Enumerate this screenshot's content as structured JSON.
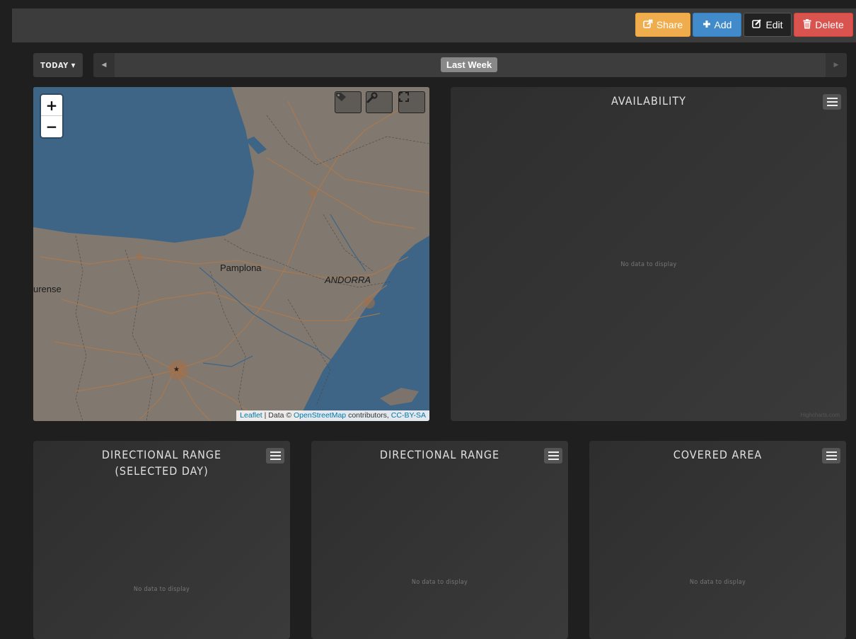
{
  "toolbar": {
    "share_label": "Share",
    "add_label": "Add",
    "edit_label": "Edit",
    "delete_label": "Delete"
  },
  "date_nav": {
    "today_label": "TODAY",
    "range_label": "Last Week"
  },
  "map": {
    "zoom_in": "+",
    "zoom_out": "−",
    "labels": {
      "pamplona": "Pamplona",
      "andorra": "ANDORRA",
      "ourense": "urense"
    },
    "attribution": {
      "leaflet": "Leaflet",
      "separator": " | Data © ",
      "osm": "OpenStreetMap",
      "contributors": " contributors, ",
      "license": "CC-BY-SA"
    }
  },
  "panels": {
    "availability": {
      "title": "AVAILABILITY",
      "no_data": "No data to display",
      "credit": "Highcharts.com"
    },
    "directional_selected": {
      "title_line1": "DIRECTIONAL RANGE",
      "title_line2": "(SELECTED DAY)",
      "no_data": "No data to display"
    },
    "directional": {
      "title": "DIRECTIONAL RANGE",
      "no_data": "No data to display"
    },
    "covered_area": {
      "title": "COVERED AREA",
      "no_data": "No data to display"
    }
  }
}
